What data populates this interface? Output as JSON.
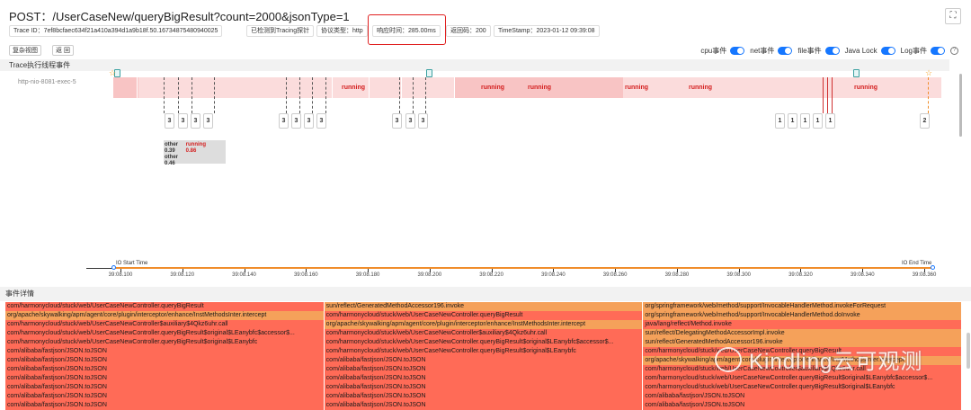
{
  "title": "POST：/UserCaseNew/queryBigResult?count=2000&jsonType=1",
  "tags": {
    "trace_id": "Trace ID：7ef8bcfaec634f21a410a394d1a9b18f.50.16734875480940025",
    "tracing": "已检测到Tracing探针",
    "protocol": "协议类型：http",
    "response": "响应时间：285.00ms",
    "code": "返回码：200",
    "timestamp": "TimeStamp：2023-01-12 09:39:08"
  },
  "buttons": {
    "restore": "复杂视图",
    "back": "返 回"
  },
  "toggles": [
    {
      "label": "cpu事件",
      "on": true
    },
    {
      "label": "net事件",
      "on": true
    },
    {
      "label": "file事件",
      "on": true
    },
    {
      "label": "Java Lock",
      "on": true
    },
    {
      "label": "Log事件",
      "on": true
    }
  ],
  "trace_header": "Trace执行线程事件",
  "thread_name": "http-nio-8081-exec-5",
  "running_label": "running",
  "event_markers": [
    "3",
    "3",
    "3",
    "3",
    "3",
    "3",
    "3",
    "3",
    "3",
    "3",
    "3",
    "1",
    "1",
    "1",
    "1",
    "1",
    "2"
  ],
  "tooltip": [
    {
      "label": "other",
      "value": "0.39"
    },
    {
      "label": "running",
      "value": "0.86"
    },
    {
      "label": "other",
      "value": "0.46"
    }
  ],
  "axis": {
    "io_start": "IO Start Time",
    "io_end": "IO End Time",
    "ticks": [
      "39:08.100",
      "39:08.120",
      "39:08.140",
      "39:08.160",
      "39:08.180",
      "39:08.200",
      "39:08.220",
      "39:08.240",
      "39:08.260",
      "39:08.280",
      "39:08.300",
      "39:08.320",
      "39:08.340",
      "39:08.360"
    ]
  },
  "events_header": "事件详情",
  "events": [
    [
      "com/harmonycloud/stuck/web/UserCaseNewController.queryBigResult",
      "sun/reflect/GeneratedMethodAccessor196.invoke",
      "org/springframework/web/method/support/InvocableHandlerMethod.invokeForRequest"
    ],
    [
      "org/apache/skywalking/apm/agent/core/plugin/interceptor/enhance/InstMethodsInter.intercept",
      "com/harmonycloud/stuck/web/UserCaseNewController.queryBigResult",
      "org/springframework/web/method/support/InvocableHandlerMethod.doInvoke"
    ],
    [
      "com/harmonycloud/stuck/web/UserCaseNewController$auxiliary$4Qkz6uhr.call",
      "org/apache/skywalking/apm/agent/core/plugin/interceptor/enhance/InstMethodsInter.intercept",
      "java/lang/reflect/Method.invoke"
    ],
    [
      "com/harmonycloud/stuck/web/UserCaseNewController.queryBigResult$original$LEanybfc$accessor$...",
      "com/harmonycloud/stuck/web/UserCaseNewController$auxiliary$4Qkz6uhr.call",
      "sun/reflect/DelegatingMethodAccessorImpl.invoke"
    ],
    [
      "com/harmonycloud/stuck/web/UserCaseNewController.queryBigResult$original$LEanybfc",
      "com/harmonycloud/stuck/web/UserCaseNewController.queryBigResult$original$LEanybfc$accessor$...",
      "sun/reflect/GeneratedMethodAccessor196.invoke"
    ],
    [
      "com/alibaba/fastjson/JSON.toJSON",
      "com/harmonycloud/stuck/web/UserCaseNewController.queryBigResult$original$LEanybfc",
      "com/harmonycloud/stuck/web/UserCaseNewController.queryBigResult"
    ],
    [
      "com/alibaba/fastjson/JSON.toJSON",
      "com/alibaba/fastjson/JSON.toJSON",
      "org/apache/skywalking/apm/agent/core/plugin/interceptor/enhance/InstMethodsInter.intercept"
    ],
    [
      "com/alibaba/fastjson/JSON.toJSON",
      "com/alibaba/fastjson/JSON.toJSON",
      "com/harmonycloud/stuck/web/UserCaseNewController$auxiliary$4Qkz6uhr.call"
    ],
    [
      "com/alibaba/fastjson/JSON.toJSON",
      "com/alibaba/fastjson/JSON.toJSON",
      "com/harmonycloud/stuck/web/UserCaseNewController.queryBigResult$original$LEanybfc$accessor$..."
    ],
    [
      "com/alibaba/fastjson/JSON.toJSON",
      "com/alibaba/fastjson/JSON.toJSON",
      "com/harmonycloud/stuck/web/UserCaseNewController.queryBigResult$original$LEanybfc"
    ],
    [
      "com/alibaba/fastjson/JSON.toJSON",
      "com/alibaba/fastjson/JSON.toJSON",
      "com/alibaba/fastjson/JSON.toJSON"
    ],
    [
      "com/alibaba/fastjson/JSON.toJSON",
      "com/alibaba/fastjson/JSON.toJSON",
      "com/alibaba/fastjson/JSON.toJSON"
    ]
  ],
  "event_colors": [
    [
      "r",
      "o",
      "o"
    ],
    [
      "o",
      "r",
      "o"
    ],
    [
      "r",
      "o",
      "r"
    ],
    [
      "r",
      "r",
      "o"
    ],
    [
      "r",
      "r",
      "o"
    ],
    [
      "r",
      "r",
      "r"
    ],
    [
      "r",
      "r",
      "o"
    ],
    [
      "r",
      "r",
      "r"
    ],
    [
      "r",
      "r",
      "r"
    ],
    [
      "r",
      "r",
      "r"
    ],
    [
      "r",
      "r",
      "r"
    ],
    [
      "r",
      "r",
      "r"
    ]
  ],
  "watermark": "Kindling云可观测"
}
